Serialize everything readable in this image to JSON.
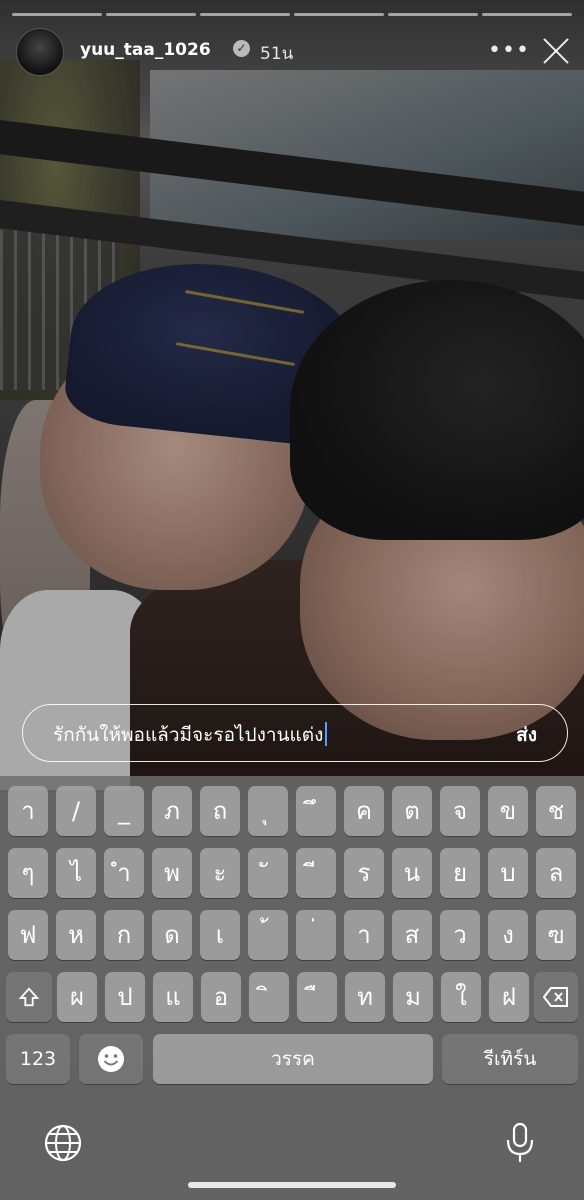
{
  "story": {
    "username": "yuu_taa_1026",
    "time": "51น",
    "progress_segments": 6,
    "more_icon": "more-horizontal-icon",
    "close_icon": "close-icon"
  },
  "reply": {
    "text": "รักกันให้พอแล้วมีจะรอไปงานแต่ง",
    "send_label": "ส่ง"
  },
  "keyboard": {
    "row1": [
      "า",
      "/",
      "_",
      "ภ",
      "ถ",
      "ุ",
      "ึ",
      "ค",
      "ต",
      "จ",
      "ข",
      "ช"
    ],
    "row2": [
      "ๆ",
      "ไ",
      "ำ",
      "พ",
      "ะ",
      "ั",
      "ี",
      "ร",
      "น",
      "ย",
      "บ",
      "ล"
    ],
    "row3": [
      "ฟ",
      "ห",
      "ก",
      "ด",
      "เ",
      "้",
      "่",
      "า",
      "ส",
      "ว",
      "ง",
      "ฃ"
    ],
    "row4": [
      "ผ",
      "ป",
      "แ",
      "อ",
      "ิ",
      "ื",
      "ท",
      "ม",
      "ใ",
      "ฝ"
    ],
    "shift_icon": "shift-icon",
    "delete_icon": "delete-icon",
    "numbers_label": "123",
    "emoji_icon": "emoji-icon",
    "space_label": "วรรค",
    "return_label": "รีเทิร์น",
    "globe_icon": "globe-icon",
    "mic_icon": "microphone-icon"
  }
}
